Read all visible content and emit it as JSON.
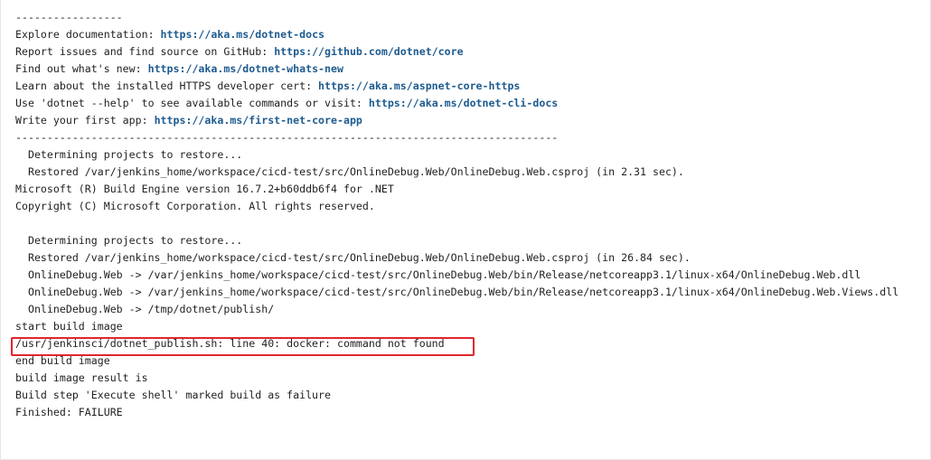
{
  "console": {
    "lines": [
      {
        "text": "-----------------",
        "link": ""
      },
      {
        "text": "Explore documentation: ",
        "link": "https://aka.ms/dotnet-docs"
      },
      {
        "text": "Report issues and find source on GitHub: ",
        "link": "https://github.com/dotnet/core"
      },
      {
        "text": "Find out what's new: ",
        "link": "https://aka.ms/dotnet-whats-new"
      },
      {
        "text": "Learn about the installed HTTPS developer cert: ",
        "link": "https://aka.ms/aspnet-core-https"
      },
      {
        "text": "Use 'dotnet --help' to see available commands or visit: ",
        "link": "https://aka.ms/dotnet-cli-docs"
      },
      {
        "text": "Write your first app: ",
        "link": "https://aka.ms/first-net-core-app"
      },
      {
        "text": "--------------------------------------------------------------------------------------",
        "link": ""
      },
      {
        "text": "  Determining projects to restore...",
        "link": ""
      },
      {
        "text": "  Restored /var/jenkins_home/workspace/cicd-test/src/OnlineDebug.Web/OnlineDebug.Web.csproj (in 2.31 sec).",
        "link": ""
      },
      {
        "text": "Microsoft (R) Build Engine version 16.7.2+b60ddb6f4 for .NET",
        "link": ""
      },
      {
        "text": "Copyright (C) Microsoft Corporation. All rights reserved.",
        "link": ""
      },
      {
        "text": "",
        "link": ""
      },
      {
        "text": "  Determining projects to restore...",
        "link": ""
      },
      {
        "text": "  Restored /var/jenkins_home/workspace/cicd-test/src/OnlineDebug.Web/OnlineDebug.Web.csproj (in 26.84 sec).",
        "link": ""
      },
      {
        "text": "  OnlineDebug.Web -> /var/jenkins_home/workspace/cicd-test/src/OnlineDebug.Web/bin/Release/netcoreapp3.1/linux-x64/OnlineDebug.Web.dll",
        "link": ""
      },
      {
        "text": "  OnlineDebug.Web -> /var/jenkins_home/workspace/cicd-test/src/OnlineDebug.Web/bin/Release/netcoreapp3.1/linux-x64/OnlineDebug.Web.Views.dll",
        "link": ""
      },
      {
        "text": "  OnlineDebug.Web -> /tmp/dotnet/publish/",
        "link": ""
      },
      {
        "text": "start build image",
        "link": ""
      },
      {
        "text": "/usr/jenkinsci/dotnet_publish.sh: line 40: docker: command not found",
        "link": ""
      },
      {
        "text": "end build image",
        "link": ""
      },
      {
        "text": "build image result is",
        "link": ""
      },
      {
        "text": "Build step 'Execute shell' marked build as failure",
        "link": ""
      },
      {
        "text": "Finished: FAILURE",
        "link": ""
      }
    ],
    "highlight_color": "#e0262d",
    "link_color": "#1e5b8f",
    "text_color": "#1f1f1f"
  }
}
